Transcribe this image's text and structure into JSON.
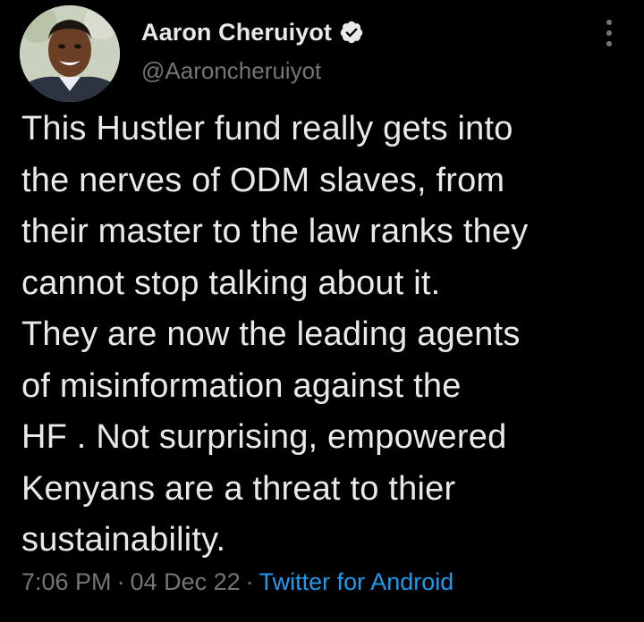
{
  "author": {
    "display_name": "Aaron Cheruiyot",
    "handle": "@Aaroncheruiyot",
    "verified": true,
    "avatar_icon": "profile-photo",
    "verified_icon": "verified-badge-icon"
  },
  "tweet": {
    "text": "This Hustler fund really gets into\nthe nerves of ODM slaves, from\ntheir master to the law ranks they\ncannot stop talking about it.\nThey are now the leading agents\nof misinformation against the\nHF . Not surprising, empowered\nKenyans are a threat to thier\nsustainability."
  },
  "meta": {
    "time": "7:06 PM",
    "separator": "·",
    "date": "04 Dec 22",
    "source": "Twitter for Android"
  },
  "colors": {
    "background": "#000000",
    "primary_text": "#e7e9ea",
    "secondary_text": "#71767b",
    "link": "#1d9bf0"
  }
}
